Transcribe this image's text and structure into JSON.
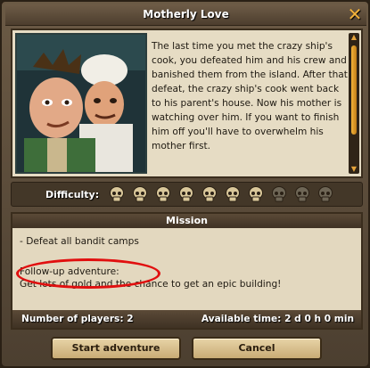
{
  "dialog": {
    "title": "Motherly Love",
    "close_icon": "close-icon"
  },
  "story": {
    "portrait": "two-characters-portrait",
    "text": "The last time you met the crazy ship's cook, you defeated him and his crew and banished them from the island. After that defeat, the crazy ship's cook went back to his parent's house. Now his mother is watching over him. If you want to finish him off you'll have to overwhelm his mother first."
  },
  "difficulty": {
    "label": "Difficulty:",
    "level": 7,
    "max": 10,
    "active_color": "#d9c79a",
    "inactive_color": "#6e6656"
  },
  "mission": {
    "header": "Mission",
    "objective": "- Defeat all bandit camps",
    "followup_title": "Follow-up adventure:",
    "followup_text": "Get lots of gold and the chance to get an epic building!",
    "players": "Number of players: 2",
    "time": "Available time: 2 d 0 h 0 min",
    "highlight_color": "#e10f0f"
  },
  "buttons": {
    "start": "Start adventure",
    "cancel": "Cancel"
  }
}
